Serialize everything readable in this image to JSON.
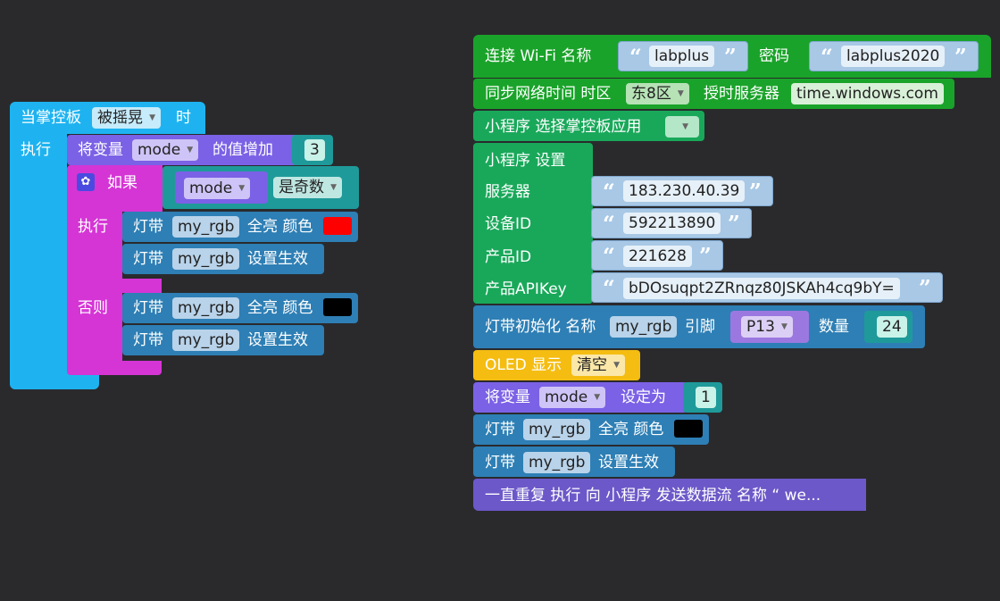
{
  "colors": {
    "background": "#2a2a2d",
    "event": "#1eb3f0",
    "variable": "#7b61e6",
    "logic": "#d535d5",
    "math": "#1f9a9a",
    "led": "#2e7fb5",
    "wifi": "#1aa32a",
    "miniapp": "#19a85a",
    "oled": "#f5bd12",
    "loop": "#6c58c8"
  },
  "left": {
    "event": {
      "prefix": "当掌控板",
      "option": "被摇晃",
      "suffix": "时",
      "do_label": "执行"
    },
    "inc": {
      "prefix": "将变量",
      "var": "mode",
      "suffix": "的值增加",
      "value": "3"
    },
    "if": {
      "label": "如果",
      "var": "mode",
      "cond": "是奇数",
      "then_label": "执行",
      "else_label": "否则"
    },
    "led_on_1": {
      "prefix": "灯带",
      "name": "my_rgb",
      "suffix": "全亮 颜色",
      "color": "#ff0000"
    },
    "led_show_1": {
      "prefix": "灯带",
      "name": "my_rgb",
      "suffix": "设置生效"
    },
    "led_on_2": {
      "prefix": "灯带",
      "name": "my_rgb",
      "suffix": "全亮 颜色",
      "color": "#000000"
    },
    "led_show_2": {
      "prefix": "灯带",
      "name": "my_rgb",
      "suffix": "设置生效"
    }
  },
  "right": {
    "wifi": {
      "prefix": "连接 Wi-Fi 名称",
      "ssid": "labplus",
      "pwd_label": "密码",
      "password": "labplus2020"
    },
    "ntp": {
      "prefix": "同步网络时间 时区",
      "zone": "东8区",
      "server_label": "授时服务器",
      "server": "time.windows.com"
    },
    "miniapp_select": {
      "label": "小程序  选择掌控板应用"
    },
    "miniapp_set": {
      "title": "小程序 设置",
      "server_label": "服务器",
      "server": "183.230.40.39",
      "device_label": "设备ID",
      "device": "592213890",
      "product_label": "产品ID",
      "product": "221628",
      "apikey_label": "产品APIKey",
      "apikey": "bDOsuqpt2ZRnqz80JSKAh4cq9bY="
    },
    "led_init": {
      "prefix": "灯带初始化 名称",
      "name": "my_rgb",
      "pin_label": "引脚",
      "pin": "P13",
      "count_label": "数量",
      "count": "24"
    },
    "oled": {
      "prefix": "OLED 显示",
      "option": "清空"
    },
    "setvar": {
      "prefix": "将变量",
      "var": "mode",
      "suffix": "设定为",
      "value": "1"
    },
    "led_on": {
      "prefix": "灯带",
      "name": "my_rgb",
      "suffix": "全亮 颜色",
      "color": "#000000"
    },
    "led_show": {
      "prefix": "灯带",
      "name": "my_rgb",
      "suffix": "设置生效"
    },
    "loop": {
      "text": "一直重复 执行 向 小程序 发送数据流 名称  “ we..."
    }
  }
}
